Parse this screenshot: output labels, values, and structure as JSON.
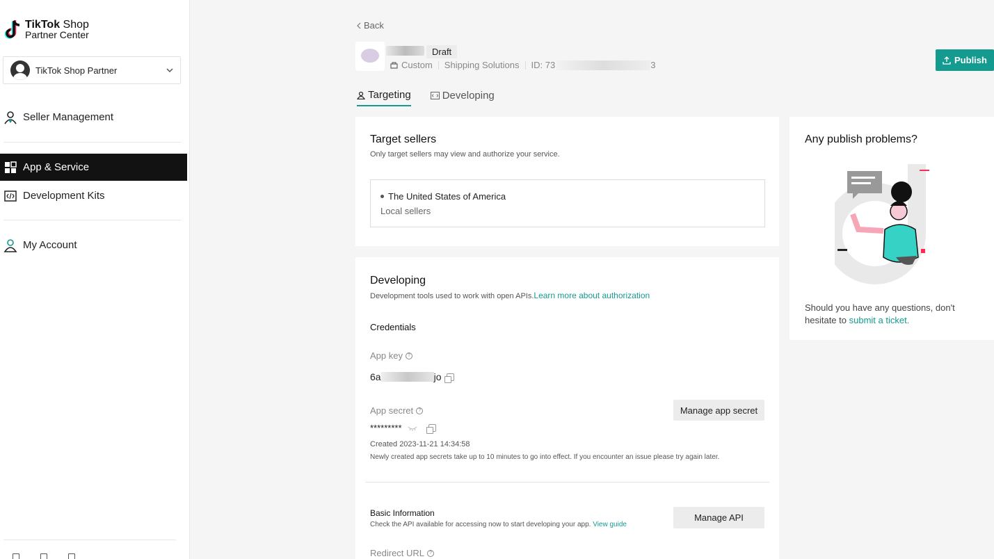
{
  "sidebar": {
    "logo_line1_bold": "TikTok",
    "logo_line1_thin": " Shop",
    "logo_line2": "Partner Center",
    "account_name": "TikTok Shop Partner",
    "items": [
      {
        "label": "Seller Management",
        "icon": "seller-management-icon"
      },
      {
        "label": "App & Service",
        "icon": "app-service-icon",
        "active": true
      },
      {
        "label": "Development Kits",
        "icon": "development-kits-icon"
      },
      {
        "label": "My Account",
        "icon": "my-account-icon"
      }
    ]
  },
  "header": {
    "back_label": "Back",
    "status_badge": "Draft",
    "meta_type": "Custom",
    "meta_category": "Shipping Solutions",
    "meta_id_prefix": "ID: 73",
    "meta_id_suffix": "3",
    "publish_label": "Publish"
  },
  "tabs": [
    {
      "label": "Targeting",
      "active": true
    },
    {
      "label": "Developing",
      "active": false
    }
  ],
  "target_sellers": {
    "title": "Target sellers",
    "subtitle": "Only target sellers may view and authorize your service.",
    "country": "The United States of America",
    "seller_type": "Local sellers"
  },
  "developing": {
    "title": "Developing",
    "subtitle": "Development tools used to work with open APIs.",
    "learn_more": "Learn more about authorization",
    "credentials_heading": "Credentials",
    "app_key_label": "App key",
    "app_key_prefix": "6a",
    "app_key_suffix": "jo",
    "app_secret_label": "App secret",
    "app_secret_value": "*********",
    "manage_secret_label": "Manage app secret",
    "created_text": "Created 2023-11-21 14:34:58",
    "secret_note": "Newly created app secrets take up to 10 minutes to go into effect. If you encounter an issue please try again later.",
    "basic_info_heading": "Basic Information",
    "basic_info_sub": "Check the API available for accessing now to start developing your app.",
    "view_guide": "View guide",
    "manage_api_label": "Manage API",
    "redirect_label": "Redirect URL"
  },
  "help_card": {
    "title": "Any publish problems?",
    "text": "Should you have any questions, don't hesitate to",
    "link": "submit a ticket."
  },
  "colors": {
    "accent": "#149a8f",
    "active_nav_bg": "#121212"
  }
}
